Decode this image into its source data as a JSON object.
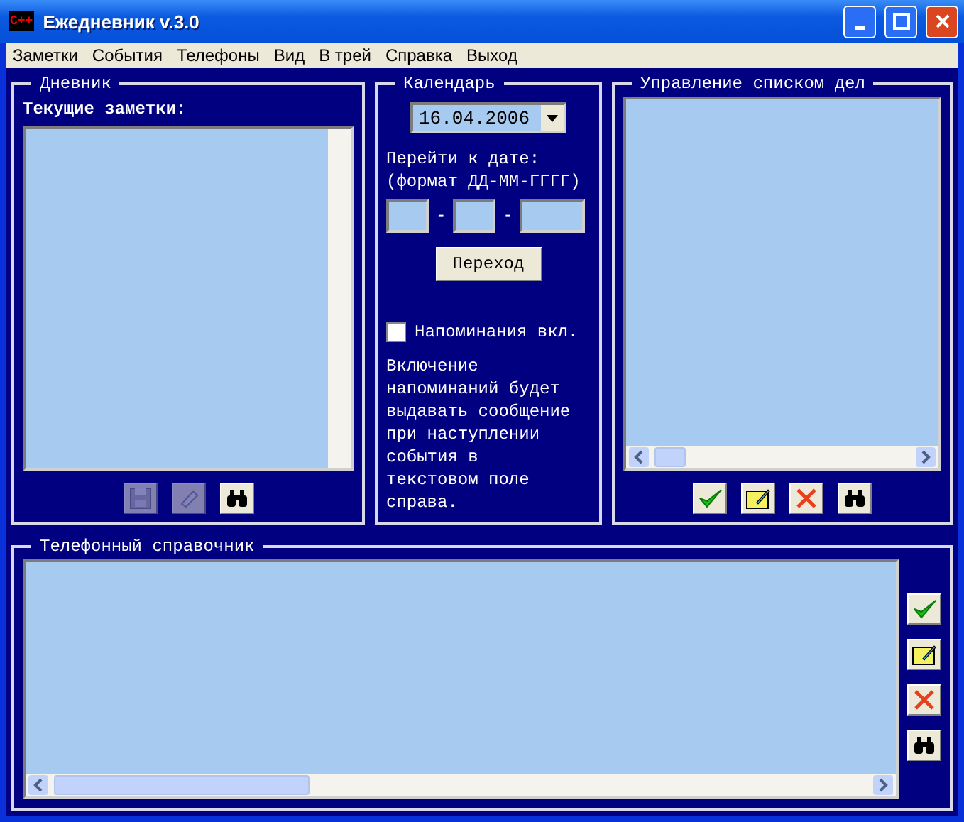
{
  "window": {
    "logo": "C++",
    "title": "Ежедневник v.3.0"
  },
  "menu": [
    "Заметки",
    "События",
    "Телефоны",
    "Вид",
    "В трей",
    "Справка",
    "Выход"
  ],
  "diary": {
    "title": "Дневник",
    "label": "Текущие заметки:",
    "buttons": [
      {
        "kind": "save",
        "disabled": true
      },
      {
        "kind": "edit",
        "disabled": true
      },
      {
        "kind": "find",
        "disabled": false
      }
    ]
  },
  "calendar": {
    "title": "Календарь",
    "date": "16.04.2006",
    "goto_label": "Перейти к дате:",
    "format_label": "(формат ДД-ММ-ГГГГ)",
    "separators": [
      "-",
      "-"
    ],
    "go_button": "Переход",
    "reminders": {
      "label": "Напоминания вкл.",
      "checked": false
    },
    "note": "Включение напоминаний будет выдавать сообщение при наступлении события в текстовом поле справа."
  },
  "todo": {
    "title": "Управление списком дел",
    "buttons": [
      {
        "kind": "ok",
        "disabled": false
      },
      {
        "kind": "new",
        "disabled": false
      },
      {
        "kind": "delete",
        "disabled": false
      },
      {
        "kind": "find",
        "disabled": false
      }
    ]
  },
  "phonebook": {
    "title": "Телефонный справочник",
    "buttons": [
      {
        "kind": "ok",
        "disabled": false
      },
      {
        "kind": "new",
        "disabled": false
      },
      {
        "kind": "delete",
        "disabled": false
      },
      {
        "kind": "find",
        "disabled": false
      }
    ]
  }
}
